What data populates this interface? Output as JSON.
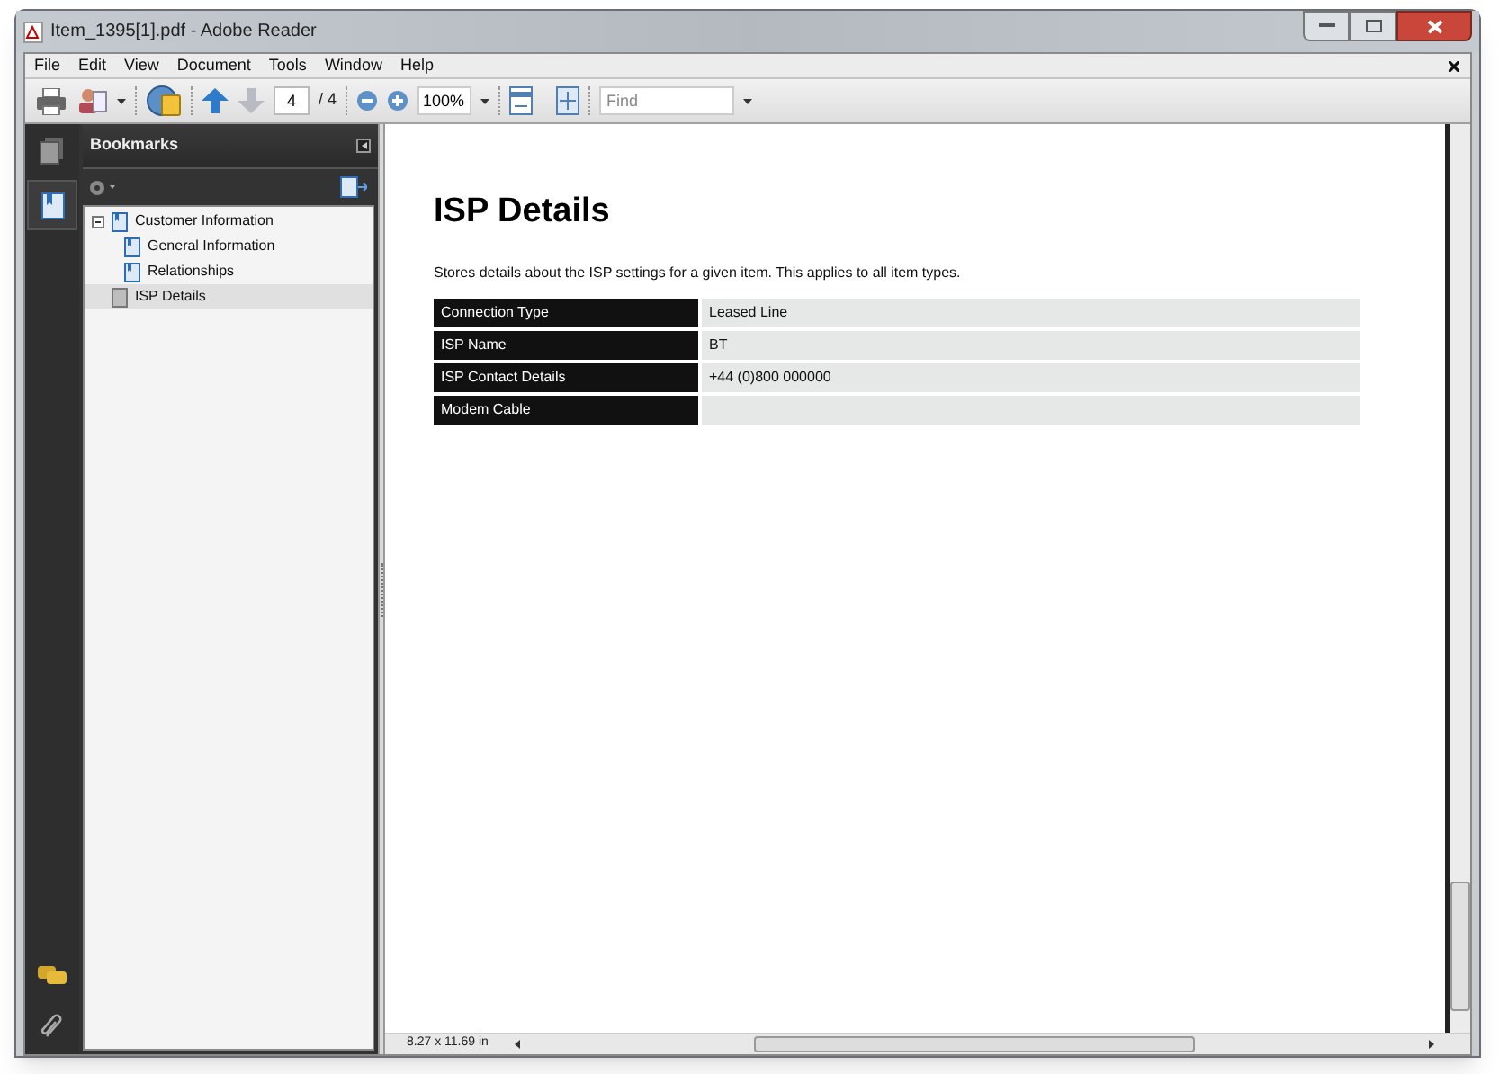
{
  "window": {
    "title": "Item_1395[1].pdf - Adobe Reader"
  },
  "menu": [
    "File",
    "Edit",
    "View",
    "Document",
    "Tools",
    "Window",
    "Help"
  ],
  "toolbar": {
    "page_number": "4",
    "page_total": "/ 4",
    "zoom": "100%",
    "find_placeholder": "Find"
  },
  "bookmarks": {
    "title": "Bookmarks",
    "items": [
      {
        "label": "Customer Information",
        "expanded": true,
        "selected": false,
        "children": [
          {
            "label": "General Information",
            "selected": false
          },
          {
            "label": "Relationships",
            "selected": false
          }
        ]
      },
      {
        "label": "ISP Details",
        "selected": true
      }
    ]
  },
  "document": {
    "heading": "ISP Details",
    "description": "Stores details about the ISP settings for a given item. This applies to all item types.",
    "rows": [
      {
        "label": "Connection Type",
        "value": "Leased Line"
      },
      {
        "label": "ISP Name",
        "value": "BT"
      },
      {
        "label": "ISP Contact Details",
        "value": "+44 (0)800 000000"
      },
      {
        "label": "Modem Cable",
        "value": ""
      }
    ]
  },
  "status_bar": {
    "page_size": "8.27 x 11.69 in"
  }
}
